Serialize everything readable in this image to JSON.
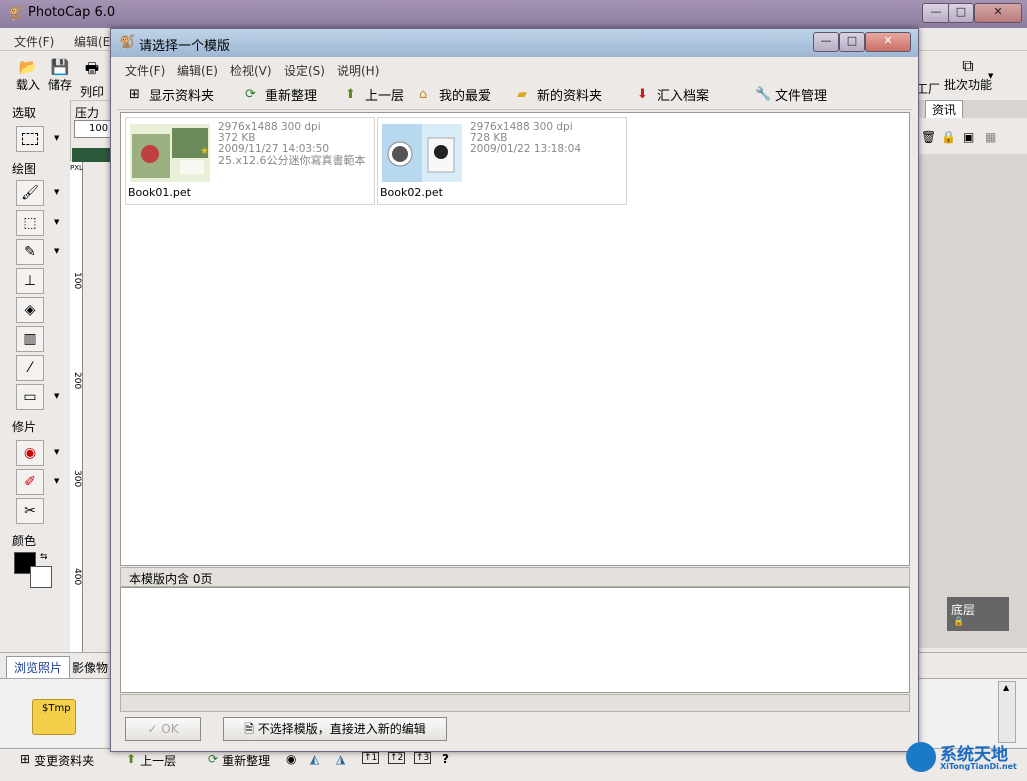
{
  "app": {
    "title": "PhotoCap 6.0",
    "menus": [
      "文件(F)",
      "编辑(E"
    ],
    "toolbar": {
      "left_buttons": [
        "载入",
        "储存",
        "列印"
      ],
      "right_buttons": [
        "工厂",
        "批次功能"
      ],
      "pressure_label": "压力",
      "pressure_value": "100"
    },
    "left_panel": {
      "select_label": "选取",
      "draw_label": "绘图",
      "retouch_label": "修片",
      "color_label": "颜色"
    },
    "ruler": {
      "unit": "PXL",
      "ticks": [
        "100",
        "200",
        "300",
        "400"
      ]
    },
    "right_panel": {
      "tab": "资讯",
      "layer_label": "底层"
    },
    "bottom_tabs": [
      "浏览照片",
      "影像物"
    ],
    "folder_label": "$Tmp",
    "status_buttons": [
      "变更资料夹",
      "上一层",
      "重新整理"
    ],
    "status_icon_labels": [
      "↑1",
      "↑2",
      "↑3",
      "?"
    ]
  },
  "dialog": {
    "title": "请选择一个模版",
    "menus": [
      "文件(F)",
      "编辑(E)",
      "检视(V)",
      "设定(S)",
      "说明(H)"
    ],
    "toolbar": [
      "显示资料夹",
      "重新整理",
      "上一层",
      "我的最爱",
      "新的资料夹",
      "汇入档案",
      "文件管理"
    ],
    "files": [
      {
        "name": "Book01.pet",
        "dimensions": "2976x1488 300 dpi",
        "size": "372 KB",
        "date": "2009/11/27 14:03:50",
        "description": "25.x12.6公分迷你寫真書範本"
      },
      {
        "name": "Book02.pet",
        "dimensions": "2976x1488 300 dpi",
        "size": "728 KB",
        "date": "2009/01/22 13:18:04",
        "description": ""
      }
    ],
    "page_info": "本模版内含 0页",
    "ok_label": "OK",
    "skip_label": "不选择模版，直接进入新的编辑"
  },
  "watermark": {
    "brand": "系统天地",
    "url": "XiTongTianDi.net"
  }
}
